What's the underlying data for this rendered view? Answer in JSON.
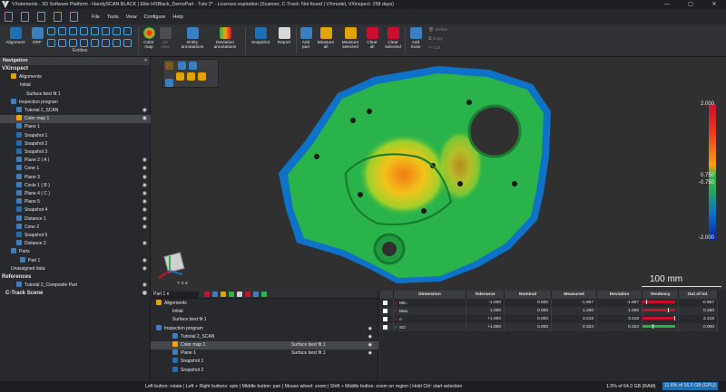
{
  "window": {
    "title": "VXelements - 3D Software Platform - HandySCAN BLACK | Elite HSBlack_DemoPart - Tuto 2* - Licenses expiration (Scanner, C-Track: Not found | VXmodel, VXinspect: 258 days)"
  },
  "menu": {
    "items": [
      "File",
      "Tools",
      "View",
      "Configure",
      "Help"
    ]
  },
  "ribbon": {
    "alignment": "Alignment",
    "drf": "DRF",
    "entities_group": "Entities",
    "color_map": "Color\nmap",
    "view_3d": "3D\nview",
    "entity_annotations": "Entity\nannotations",
    "deviation_annotations": "Deviation\nannotations",
    "snapshot": "Snapshot",
    "report": "Report",
    "add_part": "Add\npart",
    "measure_all": "Measure\nall",
    "measure_selected": "Measure\nselected",
    "clear_all": "Clear\nall",
    "clear_selected": "Clear\nselected",
    "add_scan": "Add\nScan",
    "delete": "Delete",
    "copy": "Copy",
    "cut": "Cut"
  },
  "navigation": {
    "header": "Navigation",
    "close": "×",
    "items": [
      {
        "label": "VXinspect",
        "icon": "none"
      },
      {
        "label": "Alignments",
        "icon": "alignment-icon"
      },
      {
        "label": "Initial",
        "icon": "none"
      },
      {
        "label": "Surface best fit 1",
        "icon": "none"
      },
      {
        "label": "Inspection program",
        "icon": "program-icon"
      },
      {
        "label": "Tutorial 2_SCAN",
        "icon": "scan-icon"
      },
      {
        "label": "Color map 1",
        "icon": "colormap-icon"
      },
      {
        "label": "Plane 1",
        "icon": "plane-icon"
      },
      {
        "label": "Snapshot 1",
        "icon": "snapshot-icon"
      },
      {
        "label": "Snapshot 2",
        "icon": "snapshot-icon"
      },
      {
        "label": "Snapshot 3",
        "icon": "snapshot-icon"
      },
      {
        "label": "Plane 2 ( A )",
        "icon": "plane-icon"
      },
      {
        "label": "Cone 1",
        "icon": "cone-icon"
      },
      {
        "label": "Plane 3",
        "icon": "plane-icon"
      },
      {
        "label": "Circle 1 ( B )",
        "icon": "circle-icon"
      },
      {
        "label": "Plane 4 ( C )",
        "icon": "plane-icon"
      },
      {
        "label": "Plane 5",
        "icon": "plane-icon"
      },
      {
        "label": "Snapshot 4",
        "icon": "snapshot-icon"
      },
      {
        "label": "Distance 1",
        "icon": "distance-icon"
      },
      {
        "label": "Cone 2",
        "icon": "cone-icon"
      },
      {
        "label": "Snapshot 5",
        "icon": "snapshot-icon"
      },
      {
        "label": "Distance 2",
        "icon": "distance-icon"
      },
      {
        "label": "Parts",
        "icon": "parts-icon"
      },
      {
        "label": "Part 1",
        "icon": "part-icon"
      },
      {
        "label": "Unassigned data",
        "icon": "none"
      },
      {
        "label": "References",
        "icon": "none"
      },
      {
        "label": "Tutorial 2_Composite Part",
        "icon": "part-icon"
      },
      {
        "label": "C-Track Scene",
        "icon": "none"
      }
    ]
  },
  "viewport": {
    "legend": {
      "max": "2.000",
      "upper_tol": "0.750",
      "lower_tol": "-0.750",
      "min": "-2.000"
    },
    "scale_label": "100 mm",
    "axes_label": "Y X Z"
  },
  "bottom_panel": {
    "part_selector": "Part 1",
    "rows": [
      {
        "label": "Alignments",
        "ref": ""
      },
      {
        "label": "Initial",
        "ref": ""
      },
      {
        "label": "Surface best fit 1",
        "ref": ""
      },
      {
        "label": "Inspection program",
        "ref": ""
      },
      {
        "label": "Tutorial 2_SCAN",
        "ref": ""
      },
      {
        "label": "Color map 1",
        "ref": "Surface best fit 1"
      },
      {
        "label": "Plane 1",
        "ref": "Surface best fit 1"
      },
      {
        "label": "Snapshot 1",
        "ref": ""
      },
      {
        "label": "Snapshot 2",
        "ref": ""
      }
    ]
  },
  "stats": {
    "headers": [
      "Dimension",
      "Tolerance",
      "Nominal",
      "Measured",
      "Deviation",
      "Tendency",
      "Out of tol."
    ],
    "rows": [
      {
        "dimension": "Min.",
        "tol": "-1.000",
        "nominal": "0.000",
        "measured": "-1.967",
        "deviation": "-1.967",
        "tendency": 0.1,
        "out": "-0.967",
        "color": "red"
      },
      {
        "dimension": "Max.",
        "tol": "1.000",
        "nominal": "0.000",
        "measured": "1.250",
        "deviation": "1.250",
        "tendency": 0.8,
        "out": "0.250",
        "color": "red"
      },
      {
        "dimension": "σ",
        "tol": "+1.000",
        "nominal": "0.000",
        "measured": "3.218",
        "deviation": "3.218",
        "tendency": 1.0,
        "out": "2.218",
        "color": "red"
      },
      {
        "dimension": "SD",
        "tol": "+1.000",
        "nominal": "0.000",
        "measured": "0.324",
        "deviation": "0.324",
        "tendency": 0.3,
        "out": "0.000",
        "color": "green"
      }
    ]
  },
  "statusbar": {
    "hint": "Left button: rotate  |  Left + Right buttons: spin  |  Middle button: pan  |  Mouse wheel: zoom  |  Shift + Middle button: zoom on region  |  Hold Ctrl: start selection",
    "cpu": "1.5% of 64.0 GB (RAM)",
    "gpu": "11.6% of 16.0 GB (GPU)"
  },
  "colors": {
    "accent": "#4aa3df",
    "green": "#29b34a",
    "red": "#c8102e",
    "orange": "#f8a012",
    "blue": "#0e72c8"
  }
}
